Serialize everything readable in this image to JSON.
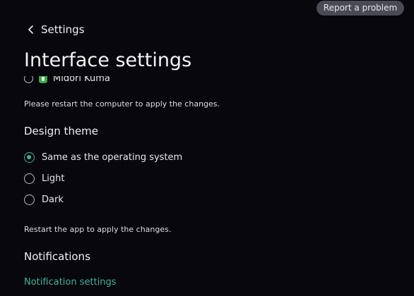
{
  "header": {
    "report_button": "Report a problem",
    "back_label": "Settings",
    "title": "Interface settings"
  },
  "partial_option": {
    "label": "Midori Kuma"
  },
  "restart_computer_note": "Please restart the computer to apply the changes.",
  "design_theme": {
    "heading": "Design theme",
    "options": [
      {
        "label": "Same as the operating system",
        "selected": true
      },
      {
        "label": "Light",
        "selected": false
      },
      {
        "label": "Dark",
        "selected": false
      }
    ],
    "note": "Restart the app to apply the changes."
  },
  "notifications": {
    "heading": "Notifications",
    "link": "Notification settings"
  },
  "colors": {
    "accent": "#3fb39a",
    "background": "#07070c"
  }
}
